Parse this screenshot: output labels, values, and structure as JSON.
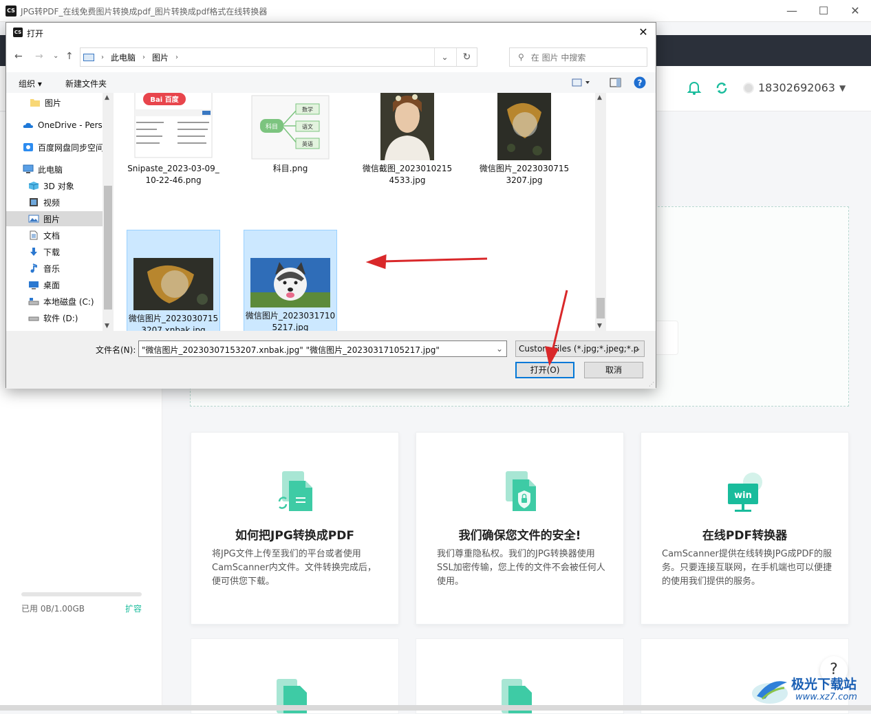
{
  "app": {
    "title": "JPG转PDF_在线免费图片转换成pdf_图片转换成pdf格式在线转换器",
    "logo_text": "CS",
    "account": "18302692063",
    "storage": "已用 0B/1.00GB",
    "expand": "扩容",
    "accent_color": "#19bc9c"
  },
  "cards": [
    {
      "title": "如何把JPG转换成PDF",
      "text": "将JPG文件上传至我们的平台或者使用CamScanner内文件。文件转换完成后，便可供您下载。",
      "icon": "file-convert-icon"
    },
    {
      "title": "我们确保您文件的安全!",
      "text": "我们尊重隐私权。我们的JPG转换器使用SSL加密传输，您上传的文件不会被任何人使用。",
      "icon": "file-lock-icon"
    },
    {
      "title": "在线PDF转换器",
      "text": "CamScanner提供在线转换JPG成PDF的服务。只要连接互联网，在手机端也可以便捷的使用我们提供的服务。",
      "icon": "win-monitor-icon",
      "badge": "win"
    }
  ],
  "help": "?",
  "watermark": {
    "title": "极光下载站",
    "url": "www.xz7.com"
  },
  "dialog": {
    "title": "打开",
    "breadcrumb": [
      "此电脑",
      "图片"
    ],
    "search_placeholder": "在 图片 中搜索",
    "organize": "组织 ▾",
    "new_folder": "新建文件夹",
    "nav_items": [
      {
        "label": "图片",
        "icon": "folder-icon"
      },
      {
        "label": "OneDrive - Perso",
        "icon": "onedrive-icon"
      },
      {
        "label": "百度网盘同步空间",
        "icon": "baidu-netdisk-icon"
      },
      {
        "label": "此电脑",
        "icon": "computer-icon"
      },
      {
        "label": "3D 对象",
        "icon": "3d-objects-icon"
      },
      {
        "label": "视频",
        "icon": "video-icon"
      },
      {
        "label": "图片",
        "icon": "pictures-icon",
        "selected": true
      },
      {
        "label": "文档",
        "icon": "documents-icon"
      },
      {
        "label": "下载",
        "icon": "download-icon"
      },
      {
        "label": "音乐",
        "icon": "music-icon"
      },
      {
        "label": "桌面",
        "icon": "desktop-icon"
      },
      {
        "label": "本地磁盘 (C:)",
        "icon": "drive-c-icon"
      },
      {
        "label": "软件 (D:)",
        "icon": "drive-d-icon"
      }
    ],
    "files": [
      {
        "name": "Snipaste_2023-03-09_10-22-46.png",
        "selected": false
      },
      {
        "name": "科目.png",
        "selected": false
      },
      {
        "name": "微信截图_20230102154533.jpg",
        "selected": false
      },
      {
        "name": "微信图片_20230307153207.jpg",
        "selected": false
      },
      {
        "name": "微信图片_20230307153207.xnbak.jpg",
        "selected": true
      },
      {
        "name": "微信图片_20230317105217.jpg",
        "selected": true
      }
    ],
    "mindmap": {
      "root": "科目",
      "children": [
        "数学",
        "语文",
        "英语"
      ]
    },
    "baidu_logo": "Bai  百度",
    "filename_label": "文件名(N):",
    "filename_value": "\"微信图片_20230307153207.xnbak.jpg\" \"微信图片_20230317105217.jpg\"",
    "filetype": "Custom Files (*.jpg;*.jpeg;*.p",
    "open_button": "打开(O)",
    "cancel_button": "取消"
  }
}
